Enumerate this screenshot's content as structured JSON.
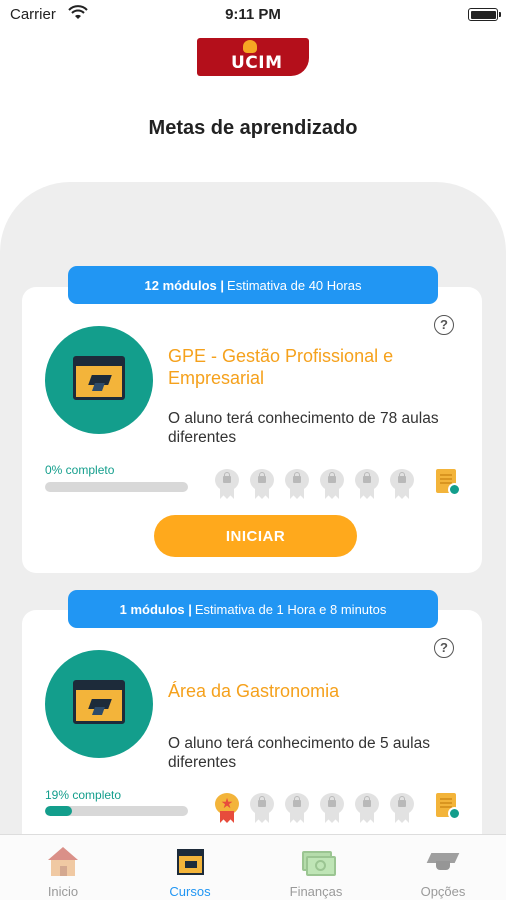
{
  "status_bar": {
    "carrier": "Carrier",
    "time": "9:11 PM"
  },
  "logo": {
    "text": "UCIM"
  },
  "page": {
    "title": "Metas de aprendizado"
  },
  "courses": [
    {
      "banner_bold": "12 módulos |",
      "banner_rest": "Estimativa de 40 Horas",
      "title": "GPE - Gestão Profissional e Empresarial",
      "description": "O aluno terá conhecimento de 78 aulas diferentes",
      "progress_label": "0% completo",
      "progress_fraction": 0,
      "badges": [
        "locked",
        "locked",
        "locked",
        "locked",
        "locked",
        "locked"
      ],
      "button_label": "INICIAR"
    },
    {
      "banner_bold": "1 módulos |",
      "banner_rest": "Estimativa de 1 Hora e 8 minutos",
      "title": "Área da Gastronomia",
      "description": "O aluno terá conhecimento de 5 aulas diferentes",
      "progress_label": "19% completo",
      "progress_fraction": 0.19,
      "badges": [
        "earned",
        "locked",
        "locked",
        "locked",
        "locked",
        "locked"
      ]
    }
  ],
  "help_icon": {
    "glyph": "?"
  },
  "tabs": [
    {
      "label": "Inicio",
      "icon": "home-icon"
    },
    {
      "label": "Cursos",
      "icon": "courses-icon",
      "active": true
    },
    {
      "label": "Finanças",
      "icon": "money-icon"
    },
    {
      "label": "Opções",
      "icon": "graduation-cap-icon"
    }
  ],
  "colors": {
    "accent": "#2196f3",
    "teal": "#139e8c",
    "orange": "#ffa91c",
    "brand_red": "#b40f1b"
  }
}
